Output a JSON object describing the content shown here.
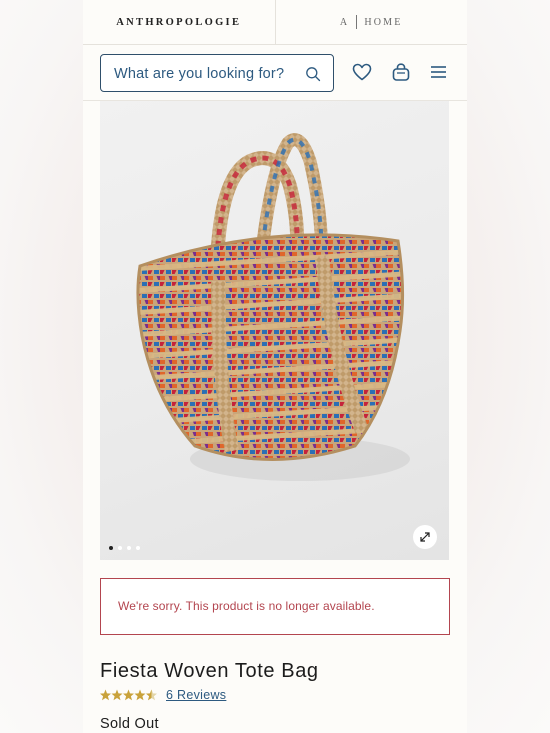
{
  "brand_tabs": {
    "primary": "ANTHROPOLOGIE",
    "secondary_mark": "A",
    "secondary_label": "HOME"
  },
  "header": {
    "search_placeholder": "What are you looking for?",
    "icons": [
      "search-icon",
      "heart-icon",
      "shopping-bag-icon",
      "menu-icon"
    ]
  },
  "gallery": {
    "image_count": 4,
    "active_index": 0,
    "expand_icon": "expand-icon"
  },
  "alert": {
    "message": "We're sorry. This product is no longer available."
  },
  "product": {
    "title": "Fiesta Woven Tote Bag",
    "rating": 4.5,
    "rating_max": 5,
    "reviews_label": "6 Reviews",
    "status": "Sold Out"
  },
  "colors": {
    "accent_blue": "#2d5a80",
    "alert_red": "#b3454f",
    "star_gold": "#c9a23a"
  }
}
